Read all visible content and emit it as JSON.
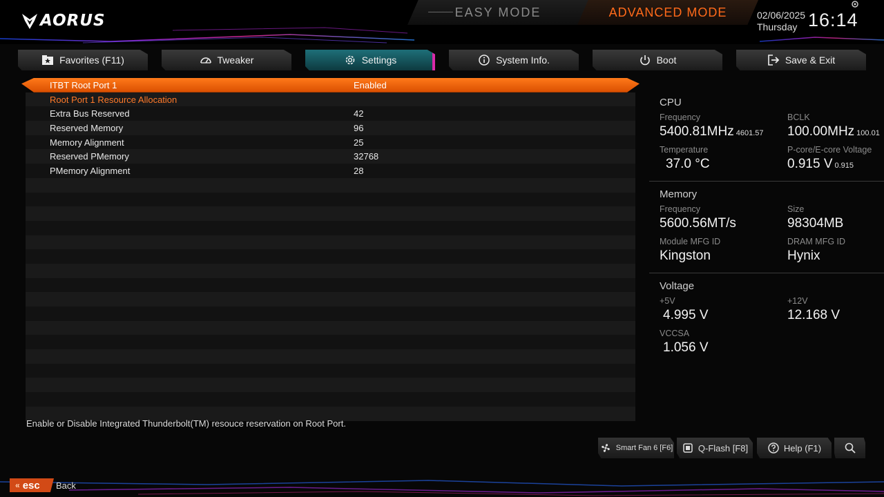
{
  "header": {
    "logo_text": "AORUS",
    "easy_mode": "EASY MODE",
    "advanced_mode": "ADVANCED MODE",
    "date": "02/06/2025",
    "day": "Thursday",
    "time": "16:14",
    "accent_color": "#ff6a1a"
  },
  "tabs": [
    {
      "label": "Favorites (F11)",
      "icon": "star-folder-icon"
    },
    {
      "label": "Tweaker",
      "icon": "gauge-icon"
    },
    {
      "label": "Settings",
      "icon": "gear-icon",
      "active": true
    },
    {
      "label": "System Info.",
      "icon": "info-icon"
    },
    {
      "label": "Boot",
      "icon": "power-icon"
    },
    {
      "label": "Save & Exit",
      "icon": "exit-icon"
    }
  ],
  "settings": [
    {
      "label": "ITBT Root Port 1",
      "value": "Enabled"
    },
    {
      "label": "Root Port 1 Resource Allocation",
      "value": ""
    },
    {
      "label": "Extra Bus Reserved",
      "value": "42"
    },
    {
      "label": "Reserved Memory",
      "value": "96"
    },
    {
      "label": "Memory Alignment",
      "value": "25"
    },
    {
      "label": "Reserved PMemory",
      "value": "32768"
    },
    {
      "label": "PMemory Alignment",
      "value": "28"
    }
  ],
  "help_text": "Enable or Disable Integrated Thunderbolt(TM) resouce reservation on Root Port.",
  "cpu": {
    "title": "CPU",
    "frequency_label": "Frequency",
    "frequency": "5400.81MHz",
    "frequency_sub": "4601.57",
    "bclk_label": "BCLK",
    "bclk": "100.00MHz",
    "bclk_sub": "100.01",
    "temp_label": "Temperature",
    "temp": "37.0 °C",
    "voltage_label": "P-core/E-core Voltage",
    "voltage": "0.915 V",
    "voltage_sub": "0.915"
  },
  "memory": {
    "title": "Memory",
    "frequency_label": "Frequency",
    "frequency": "5600.56MT/s",
    "size_label": "Size",
    "size": "98304MB",
    "module_label": "Module MFG ID",
    "module": "Kingston",
    "dram_label": "DRAM MFG ID",
    "dram": "Hynix"
  },
  "voltage": {
    "title": "Voltage",
    "v5_label": "+5V",
    "v5": "4.995 V",
    "v12_label": "+12V",
    "v12": "12.168 V",
    "vccsa_label": "VCCSA",
    "vccsa": "1.056 V"
  },
  "tools": {
    "smart_fan": "Smart Fan 6 [F6]",
    "qflash": "Q-Flash [F8]",
    "help": "Help (F1)"
  },
  "footer": {
    "esc": "esc",
    "back": "Back"
  }
}
